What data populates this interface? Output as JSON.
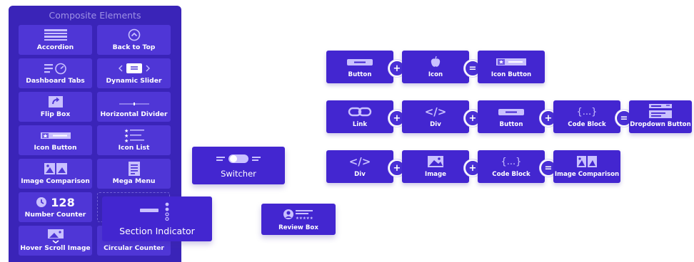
{
  "panel": {
    "title": "Composite Elements",
    "tiles": [
      {
        "label": "Accordion",
        "icon": "accordion-icon"
      },
      {
        "label": "Back to Top",
        "icon": "chevron-up-circle-icon"
      },
      {
        "label": "Dashboard Tabs",
        "icon": "dashboard-tabs-icon"
      },
      {
        "label": "Dynamic Slider",
        "icon": "dynamic-slider-icon"
      },
      {
        "label": "Flip Box",
        "icon": "flip-box-icon"
      },
      {
        "label": "Horizontal Divider",
        "icon": "horizontal-divider-icon"
      },
      {
        "label": "Icon Button",
        "icon": "icon-button-icon"
      },
      {
        "label": "Icon List",
        "icon": "icon-list-icon"
      },
      {
        "label": "Image Comparison",
        "icon": "image-comparison-icon"
      },
      {
        "label": "Mega Menu",
        "icon": "mega-menu-icon"
      },
      {
        "label": "Number Counter",
        "icon": "number-counter-icon",
        "value": "128"
      },
      {
        "label": "Hover Scroll Image",
        "icon": "hover-scroll-image-icon"
      },
      {
        "label": "Circular Counter",
        "icon": "circular-counter-icon"
      }
    ]
  },
  "floating": {
    "section_indicator": "Section Indicator",
    "switcher": "Switcher",
    "review_box": "Review Box"
  },
  "equations": {
    "row1": {
      "items": [
        "Button",
        "Icon",
        "Icon Button"
      ],
      "ops": [
        "+",
        "="
      ]
    },
    "row2": {
      "items": [
        "Link",
        "Div",
        "Button",
        "Code Block",
        "Dropdown Button"
      ],
      "ops": [
        "+",
        "+",
        "+",
        "="
      ]
    },
    "row3": {
      "items": [
        "Div",
        "Image",
        "Code Block",
        "Image Comparison"
      ],
      "ops": [
        "+",
        "+",
        "="
      ]
    },
    "glyphs": {
      "div": "</>",
      "code": "{...}"
    }
  },
  "colors": {
    "panel_bg": "#3a24b8",
    "tile_bg": "#4f36d6",
    "element_bg": "#4326d0",
    "icon_light": "#c9c0ff",
    "title_text": "#9f92e6"
  }
}
